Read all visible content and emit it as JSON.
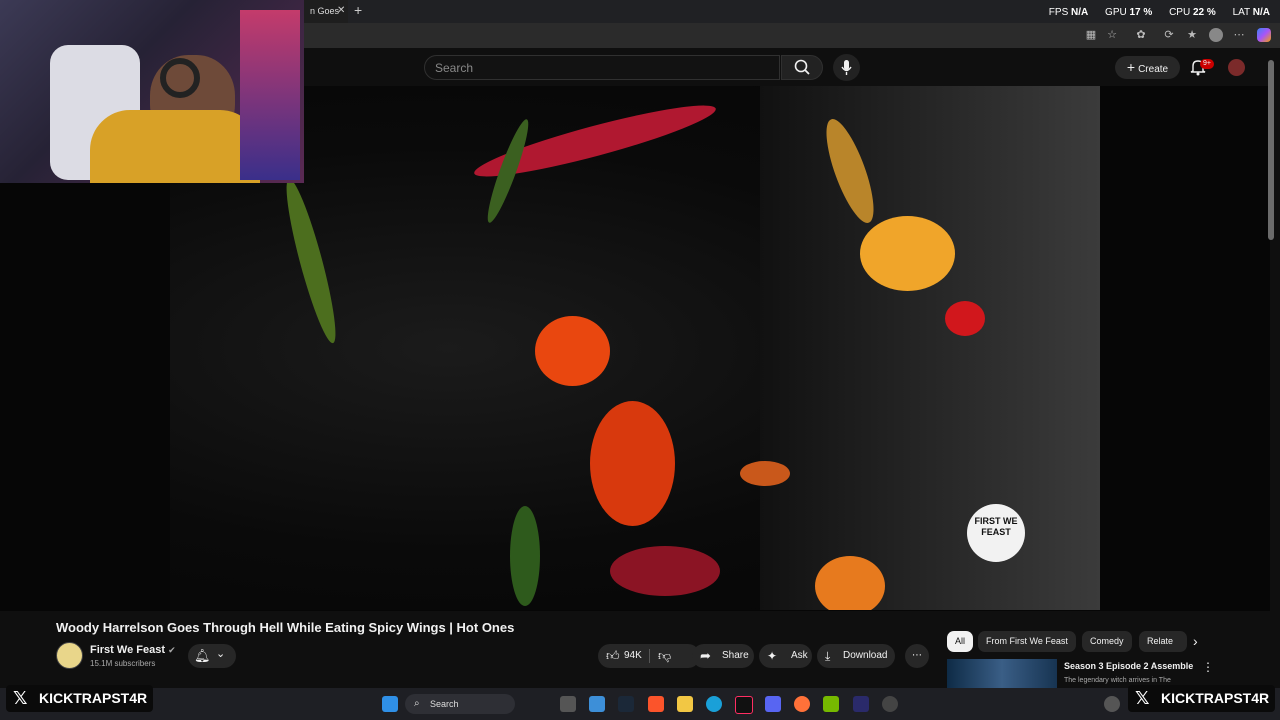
{
  "browser": {
    "tab_title": "n Goes",
    "tab_close": "✕",
    "new_tab": "+",
    "stats": {
      "fps_label": "FPS",
      "fps_value": "N/A",
      "gpu_label": "GPU",
      "gpu_value": "17 %",
      "cpu_label": "CPU",
      "cpu_value": "22 %",
      "lat_label": "LAT",
      "lat_value": "N/A"
    }
  },
  "header": {
    "search_placeholder": "Search",
    "create_label": "Create",
    "notification_badge": "9+"
  },
  "video": {
    "title": "Woody Harrelson Goes Through Hell While Eating Spicy Wings | Hot Ones",
    "watermark_text": "FIRST WE FEAST"
  },
  "channel": {
    "name": "First We Feast",
    "subscribers": "15.1M subscribers"
  },
  "actions": {
    "likes": "94K",
    "share": "Share",
    "ask": "Ask",
    "download": "Download"
  },
  "chips": [
    "All",
    "From First We Feast",
    "Comedy",
    "Relate"
  ],
  "recommendation": {
    "title": "Season 3 Episode 2 Assemble",
    "description": "The legendary witch arrives in The"
  },
  "taskbar": {
    "search_label": "Search"
  },
  "overlays": {
    "handle_left": "KICKTRAPST4R",
    "handle_right": "KICKTRAPST4R"
  },
  "colors": {
    "accent": "#cc0000",
    "background": "#0f0f0f",
    "chip_active": "#f1f1f1"
  }
}
